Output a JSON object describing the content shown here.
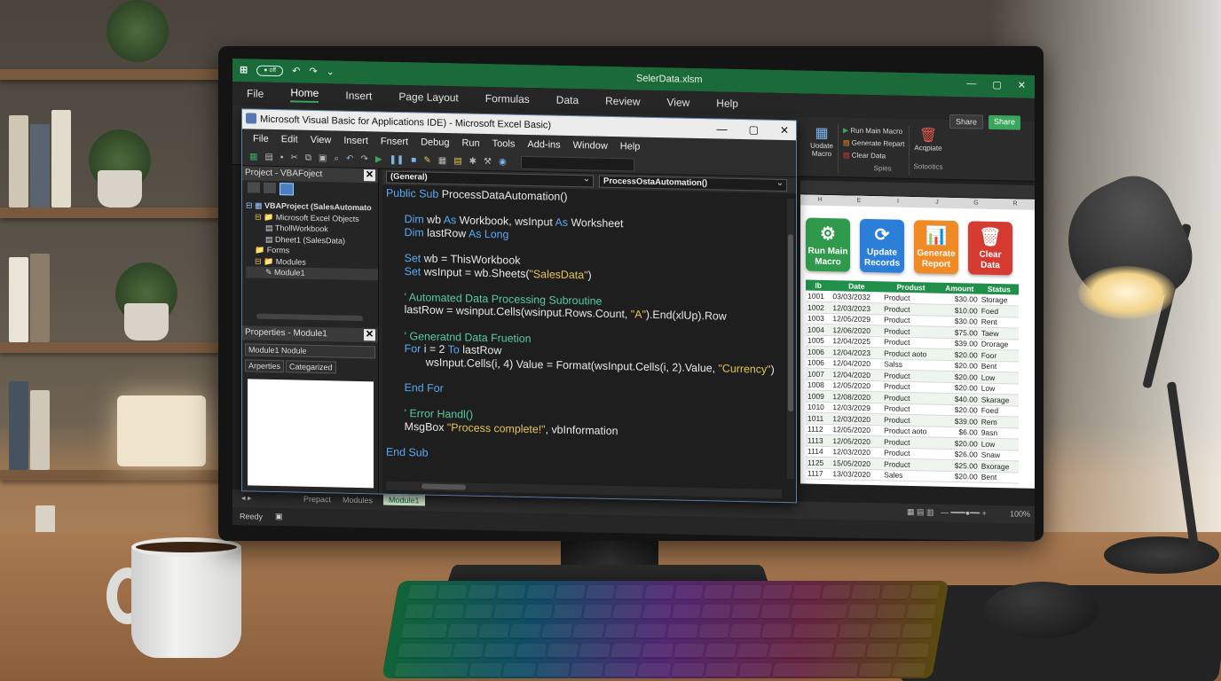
{
  "excel": {
    "filename": "SelerData.xlsm",
    "window_controls": [
      "—",
      "▢",
      "✕"
    ],
    "menu": [
      "File",
      "Home",
      "Insert",
      "Page Layout",
      "Formulas",
      "Data",
      "Review",
      "View",
      "Help"
    ],
    "share_small": "Share",
    "share_green": "Share",
    "ribbon": {
      "update_macro": "Uodate Macro",
      "run_main": "Run Main Macro",
      "generate": "Generate Repart",
      "clear": "Clear Data",
      "group_spies": "Spies",
      "acquire": "Acqpiate",
      "group_sotootics": "Sotootics"
    },
    "columns": [
      "H",
      "E",
      "I",
      "J",
      "G",
      "R"
    ],
    "buttons": [
      {
        "label": "Run Main Macro",
        "icon": "⚙",
        "color": "#2f9a4c"
      },
      {
        "label": "Update Records",
        "icon": "⟳",
        "color": "#2c7fd8"
      },
      {
        "label": "Generate Report",
        "icon": "📊",
        "color": "#f08a24"
      },
      {
        "label": "Clear Data",
        "icon": "🗑",
        "color": "#d63b32"
      }
    ],
    "table": {
      "headers": [
        "Ib",
        "Date",
        "Produst",
        "Amount",
        "Status"
      ],
      "rows": [
        [
          "1001",
          "03/03/2032",
          "Product",
          "$30.00",
          "Storage"
        ],
        [
          "1002",
          "12/03/2023",
          "Product",
          "$10.00",
          "Foed"
        ],
        [
          "1003",
          "12/05/2029",
          "Product",
          "$30.00",
          "Rent"
        ],
        [
          "1004",
          "12/06/2020",
          "Product",
          "$75.00",
          "Taew"
        ],
        [
          "1005",
          "12/04/2025",
          "Product",
          "$39.00",
          "Drorage"
        ],
        [
          "1006",
          "12/04/2023",
          "Product aoto",
          "$20.00",
          "Foor"
        ],
        [
          "1006",
          "12/04/2020",
          "Salss",
          "$20.00",
          "Bent"
        ],
        [
          "1007",
          "12/04/2020",
          "Product",
          "$20.00",
          "Low"
        ],
        [
          "1008",
          "12/05/2020",
          "Product",
          "$20.00",
          "Low"
        ],
        [
          "1009",
          "12/08/2020",
          "Product",
          "$40.00",
          "Skarage"
        ],
        [
          "1010",
          "12/03/2029",
          "Product",
          "$20.00",
          "Foed"
        ],
        [
          "1011",
          "12/03/2020",
          "Product",
          "$39.00",
          "Rem"
        ],
        [
          "1112",
          "12/05/2020",
          "Product aoto",
          "$6.00",
          "9asn"
        ],
        [
          "1113",
          "12/05/2020",
          "Product",
          "$20.00",
          "Low"
        ],
        [
          "1114",
          "12/03/2020",
          "Product",
          "$26.00",
          "Snaw"
        ],
        [
          "1125",
          "15/05/2020",
          "Product",
          "$25.00",
          "Bxorage"
        ],
        [
          "1117",
          "13/03/2020",
          "Sales",
          "$20.00",
          "Bent"
        ]
      ]
    },
    "sheet_tabs": [
      "Prepact",
      "Modules",
      "Module1"
    ],
    "status": "Reedy",
    "zoom": "100%"
  },
  "vba": {
    "title": "Microsoft Visual Basic for Applications IDE) - Microsoft Excel Basic)",
    "menu": [
      "File",
      "Edit",
      "View",
      "Insert",
      "Fnsert",
      "Debug",
      "Run",
      "Tools",
      "Add-ins",
      "Window",
      "Help"
    ],
    "project_title": "Project - VBAFoject",
    "tree": [
      {
        "label": "VBAProject (SalesAutomato",
        "level": 0
      },
      {
        "label": "Microsoft Excel Objects",
        "level": 1
      },
      {
        "label": "ThollWorkbook",
        "level": 2
      },
      {
        "label": "Dheet1 (SalesData)",
        "level": 2
      },
      {
        "label": "Forms",
        "level": 1
      },
      {
        "label": "Modules",
        "level": 1
      },
      {
        "label": "Module1",
        "level": 2
      }
    ],
    "props_title": "Properties - Module1",
    "props_select": "Module1 Nodule",
    "props_tabs": [
      "Arperties",
      "Categarized"
    ],
    "combo_left": "(General)",
    "combo_right": "ProcessOstaAutomation()",
    "code": [
      {
        "t": [
          [
            "kw",
            "Public Sub "
          ],
          [
            "fn",
            "ProcessDataAutomation()"
          ]
        ],
        "i": 0
      },
      {
        "t": [],
        "i": 0
      },
      {
        "t": [
          [
            "kw",
            "Dim "
          ],
          [
            "fn",
            "wb "
          ],
          [
            "kw",
            "As "
          ],
          [
            "fn",
            "Workbook, wsInput "
          ],
          [
            "kw",
            "As "
          ],
          [
            "fn",
            "Worksheet"
          ]
        ],
        "i": 1
      },
      {
        "t": [
          [
            "kw",
            "Dim "
          ],
          [
            "fn",
            "lastRow "
          ],
          [
            "kw",
            "As Long"
          ]
        ],
        "i": 1
      },
      {
        "t": [],
        "i": 0
      },
      {
        "t": [
          [
            "kw",
            "Set "
          ],
          [
            "fn",
            "wb = ThisWorkbook"
          ]
        ],
        "i": 1
      },
      {
        "t": [
          [
            "kw",
            "Set "
          ],
          [
            "fn",
            "wsInput = wb.Sheets("
          ],
          [
            "str",
            "\"SalesData\""
          ],
          [
            "fn",
            ")"
          ]
        ],
        "i": 1
      },
      {
        "t": [],
        "i": 0
      },
      {
        "t": [
          [
            "cm",
            "' Automated Data Processing Subroutine"
          ]
        ],
        "i": 1
      },
      {
        "t": [
          [
            "fn",
            "lastRow = wsinput.Cells(wsinput.Rows.Count, "
          ],
          [
            "str",
            "\"A\""
          ],
          [
            "fn",
            ").End(xlUp).Row"
          ]
        ],
        "i": 1
      },
      {
        "t": [],
        "i": 0
      },
      {
        "t": [
          [
            "cm",
            "' Generatnd Data Fruetion"
          ]
        ],
        "i": 1
      },
      {
        "t": [
          [
            "kw",
            "For "
          ],
          [
            "fn",
            "i = 2 "
          ],
          [
            "kw",
            "To "
          ],
          [
            "fn",
            "lastRow"
          ]
        ],
        "i": 1
      },
      {
        "t": [
          [
            "fn",
            "wsInput.Cells(i, 4) Value = Format(wsInput.Cells(i, 2).Value, "
          ],
          [
            "str",
            "\"Currency\""
          ],
          [
            "fn",
            ")"
          ]
        ],
        "i": 2
      },
      {
        "t": [],
        "i": 0
      },
      {
        "t": [
          [
            "kw",
            "End For"
          ]
        ],
        "i": 1
      },
      {
        "t": [],
        "i": 0
      },
      {
        "t": [
          [
            "cm",
            "' Error Handl()"
          ]
        ],
        "i": 1
      },
      {
        "t": [
          [
            "fn",
            "MsgBox "
          ],
          [
            "str",
            "\"Process complete!\""
          ],
          [
            "fn",
            ", vbInformation"
          ]
        ],
        "i": 1
      },
      {
        "t": [],
        "i": 0
      },
      {
        "t": [
          [
            "kw",
            "End Sub"
          ]
        ],
        "i": 0
      }
    ]
  }
}
